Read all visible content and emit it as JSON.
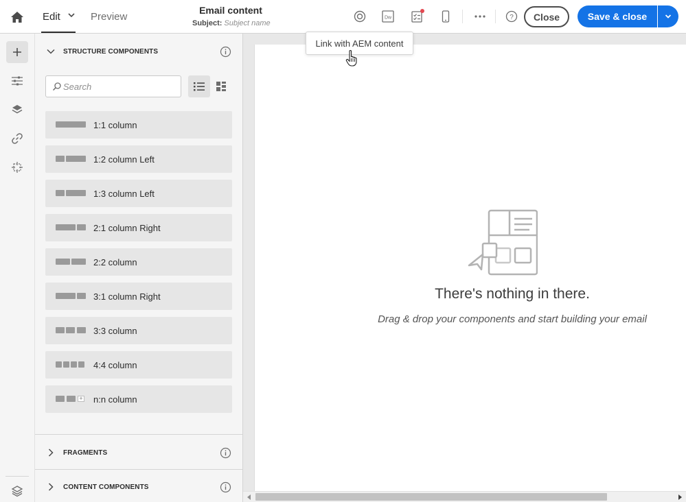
{
  "header": {
    "mode_tabs": [
      "Edit",
      "Preview"
    ],
    "title": "Email content",
    "subject_label": "Subject:",
    "subject_placeholder": "Subject name",
    "close_label": "Close",
    "save_label": "Save & close",
    "tools": [
      "gear-badge-icon",
      "dreamweaver-icon",
      "checklist-icon",
      "mobile-icon",
      "more-icon",
      "help-icon"
    ]
  },
  "tooltip": {
    "text": "Link with AEM content"
  },
  "rail": {
    "items": [
      "add-icon",
      "settings-sliders-icon",
      "layers-icon",
      "link-icon",
      "target-icon",
      "layers-settings-icon"
    ]
  },
  "panel": {
    "structure_title": "STRUCTURE COMPONENTS",
    "search_placeholder": "Search",
    "components": [
      {
        "label": "1:1 column"
      },
      {
        "label": "1:2 column Left"
      },
      {
        "label": "1:3 column Left"
      },
      {
        "label": "2:1 column Right"
      },
      {
        "label": "2:2 column"
      },
      {
        "label": "3:1 column Right"
      },
      {
        "label": "3:3 column"
      },
      {
        "label": "4:4 column"
      },
      {
        "label": "n:n column"
      }
    ],
    "fragments_title": "FRAGMENTS",
    "content_title": "CONTENT COMPONENTS"
  },
  "canvas": {
    "empty_title": "There's nothing in there.",
    "empty_subtitle": "Drag & drop your components and start building your email"
  },
  "colors": {
    "accent": "#1473e6",
    "notification": "#e34850"
  }
}
